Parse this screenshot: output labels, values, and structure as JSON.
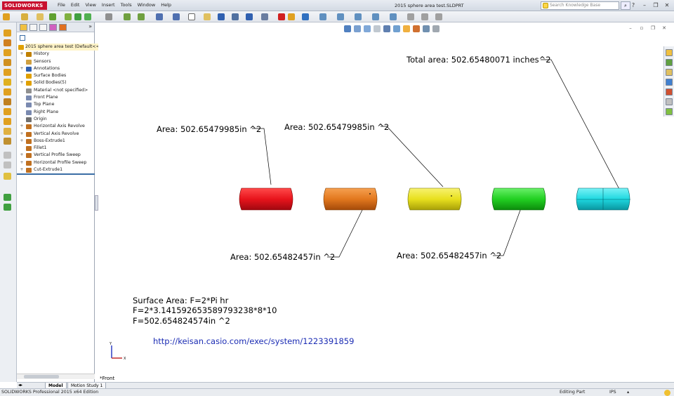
{
  "app": {
    "logo_text": "SOLIDWORKS",
    "document_title": "2015 sphere area test.SLDPRT",
    "menu": [
      "File",
      "Edit",
      "View",
      "Insert",
      "Tools",
      "Window",
      "Help"
    ],
    "search_placeholder": "Search Knowledge Base"
  },
  "feature_tree": {
    "items": [
      {
        "label": "2015 sphere area test  (Default<<",
        "icon": "part-icon",
        "color": "#e0a000",
        "expandable": false
      },
      {
        "label": "History",
        "icon": "history-icon",
        "color": "#c08000",
        "expandable": true
      },
      {
        "label": "Sensors",
        "icon": "sensor-icon",
        "color": "#d0a040",
        "expandable": false
      },
      {
        "label": "Annotations",
        "icon": "annotation-icon",
        "color": "#3060b0",
        "expandable": true
      },
      {
        "label": "Surface Bodies",
        "icon": "surface-body-icon",
        "color": "#e0a000",
        "expandable": false
      },
      {
        "label": "Solid Bodies(5)",
        "icon": "solid-body-icon",
        "color": "#e0a000",
        "expandable": true
      },
      {
        "label": "Material <not specified>",
        "icon": "material-icon",
        "color": "#909090",
        "expandable": false
      },
      {
        "label": "Front Plane",
        "icon": "plane-icon",
        "color": "#7a8ab0",
        "expandable": false
      },
      {
        "label": "Top Plane",
        "icon": "plane-icon",
        "color": "#7a8ab0",
        "expandable": false
      },
      {
        "label": "Right Plane",
        "icon": "plane-icon",
        "color": "#7a8ab0",
        "expandable": false
      },
      {
        "label": "Origin",
        "icon": "origin-icon",
        "color": "#707070",
        "expandable": false
      },
      {
        "label": "Horizontal Axis Revolve",
        "icon": "revolve-icon",
        "color": "#c07020",
        "expandable": true
      },
      {
        "label": "Vertical Axis Revolve",
        "icon": "revolve-icon",
        "color": "#c07020",
        "expandable": true
      },
      {
        "label": "Boss-Extrude1",
        "icon": "extrude-icon",
        "color": "#c07020",
        "expandable": true
      },
      {
        "label": "Fillet1",
        "icon": "fillet-icon",
        "color": "#c07020",
        "expandable": false
      },
      {
        "label": "Vertical Profile Sweep",
        "icon": "sweep-icon",
        "color": "#c07020",
        "expandable": true
      },
      {
        "label": "Horizontal Profile Sweep",
        "icon": "sweep-icon",
        "color": "#c07020",
        "expandable": true
      },
      {
        "label": "Cut-Extrude1",
        "icon": "cut-extrude-icon",
        "color": "#c07020",
        "expandable": true
      }
    ]
  },
  "bottom_tabs": [
    "Model",
    "Motion Study 1"
  ],
  "status": {
    "edition": "SOLIDWORKS Professional 2015 x64 Edition",
    "mode": "Editing Part",
    "units": "IPS"
  },
  "graphics": {
    "view_label": "*Front",
    "annotations": {
      "red": "Area: 502.65479985in ^2",
      "orange": "Area: 502.65482457in ^2",
      "yellow": "Area: 502.65479985in ^2",
      "green": "Area: 502.65482457in ^2",
      "total": "Total area: 502.65480071 inches^2"
    },
    "body_colors": {
      "red": "#e8141c",
      "orange": "#e2781e",
      "yellow": "#e8e01e",
      "green": "#22d022",
      "cyan": "#1ed8e0"
    },
    "notes": [
      "Surface Area: F=2*Pi hr",
      "F=2*3.141592653589793238*8*10",
      "F=502.654824574in ^2"
    ],
    "link": "http://keisan.casio.com/exec/system/1223391859"
  }
}
